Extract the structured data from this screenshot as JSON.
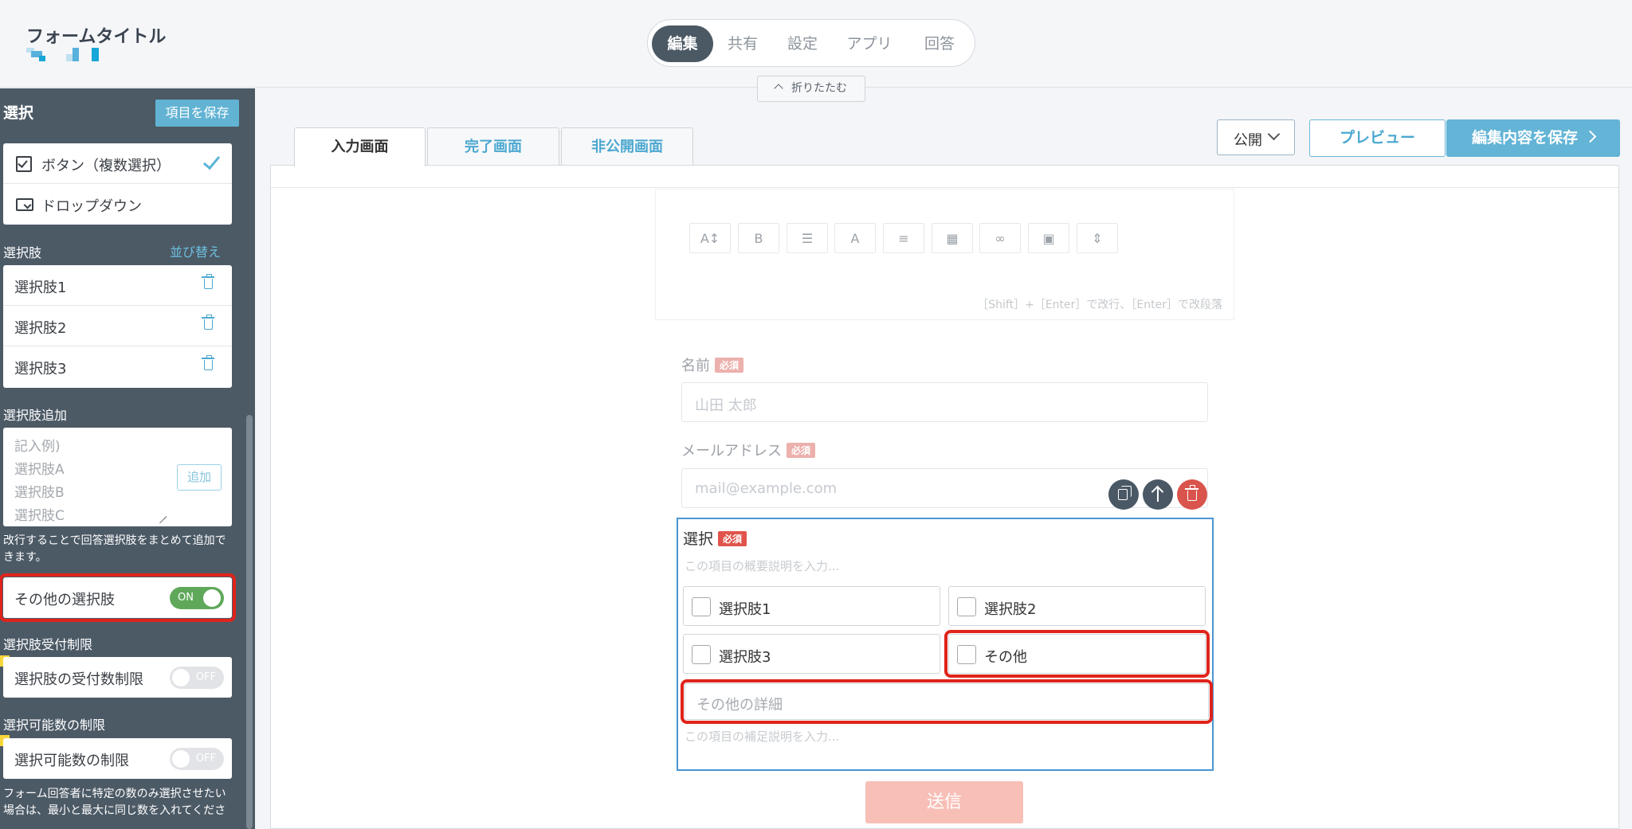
{
  "header": {
    "title": "フォームタイトル",
    "mode_tabs": [
      {
        "label": "編集",
        "active": true
      },
      {
        "label": "共有",
        "active": false
      },
      {
        "label": "設定",
        "active": false
      },
      {
        "label": "アプリ",
        "active": false
      },
      {
        "label": "回答",
        "active": false
      }
    ],
    "collapse_label": "折りたたむ",
    "logo_colors": [
      "#bfe0f1",
      "#58b1dc",
      "#17a6d8"
    ]
  },
  "sidebar": {
    "heading": "選択",
    "save_label": "項目を保存",
    "types": [
      {
        "label": "ボタン（複数選択）",
        "icon": "checkbox-icon",
        "selected": true
      },
      {
        "label": "ドロップダウン",
        "icon": "dropdown-icon",
        "selected": false
      }
    ],
    "choices_label": "選択肢",
    "reorder_label": "並び替え",
    "choices": [
      "選択肢1",
      "選択肢2",
      "選択肢3"
    ],
    "add_label": "選択肢追加",
    "add_placeholder": "記入例)\n選択肢A\n選択肢B\n選択肢C",
    "add_button": "追加",
    "add_note": "改行することで回答選択肢をまとめて追加できます。",
    "other_toggle": {
      "label": "その他の選択肢",
      "state": "ON"
    },
    "limit_section": "選択肢受付制限",
    "limit_toggle": {
      "label": "選択肢の受付数制限",
      "state": "OFF"
    },
    "count_section": "選択可能数の制限",
    "count_toggle": {
      "label": "選択可能数の制限",
      "state": "OFF"
    },
    "count_note": "フォーム回答者に特定の数のみ選択させたい場合は、最小と最大に同じ数を入れてくださ"
  },
  "editor": {
    "tabs": [
      {
        "label": "入力画面",
        "active": true
      },
      {
        "label": "完了画面",
        "active": false
      },
      {
        "label": "非公開画面",
        "active": false
      }
    ],
    "publish_label": "公開",
    "preview_label": "プレビュー",
    "save_label": "編集内容を保存",
    "toolbar_hint": "［Shift］+［Enter］で改行、［Enter］で改段落",
    "toolbar_buttons": [
      "A↕",
      "B",
      "☰",
      "A",
      "≡",
      "▦",
      "∞",
      "▣",
      "⇕"
    ],
    "colors": {
      "accent": "#63b4d6",
      "dark": "#4c5a66",
      "required": "#e0544c",
      "highlight": "#e0241b"
    }
  },
  "form": {
    "name": {
      "label": "名前",
      "required": "必須",
      "placeholder": "山田 太郎"
    },
    "email": {
      "label": "メールアドレス",
      "required": "必須",
      "placeholder": "mail@example.com"
    },
    "select": {
      "label": "選択",
      "required": "必須",
      "description_placeholder": "この項目の概要説明を入力...",
      "options": [
        "選択肢1",
        "選択肢2",
        "選択肢3",
        "その他"
      ],
      "other_placeholder": "その他の詳細",
      "footer_placeholder": "この項目の補足説明を入力..."
    },
    "submit_label": "送信"
  }
}
